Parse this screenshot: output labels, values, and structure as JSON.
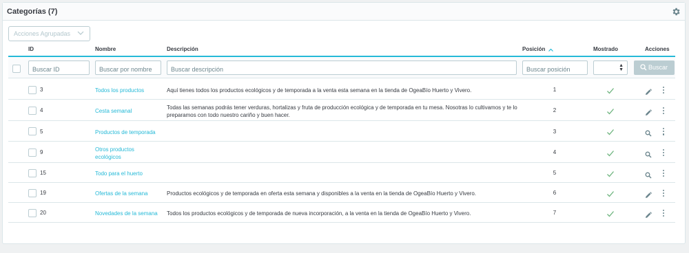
{
  "panel": {
    "title": "Categorías (7)"
  },
  "bulk_actions": {
    "label": "Acciones Agrupadas"
  },
  "columns": {
    "id": "ID",
    "name": "Nombre",
    "description": "Descripción",
    "position": "Posición",
    "displayed": "Mostrado",
    "actions": "Acciones"
  },
  "filters": {
    "id_placeholder": "Buscar ID",
    "name_placeholder": "Buscar por nombre",
    "description_placeholder": "Buscar descripción",
    "position_placeholder": "Buscar posición",
    "search_button": "Buscar"
  },
  "rows": [
    {
      "id": "3",
      "name": "Todos los productos",
      "description": "Aquí tienes todos los productos ecológicos y de temporada a la venta esta semana en la tienda de OgeaBío Huerto y Vivero.",
      "position": "1",
      "displayed": true,
      "action_icon": "edit-icon"
    },
    {
      "id": "4",
      "name": "Cesta semanal",
      "description": "Todas las semanas podrás tener verduras, hortalizas y fruta de producción ecológica y de temporada en tu mesa. Nosotras lo cultivamos y te lo preparamos con todo nuestro cariño y buen hacer.",
      "position": "2",
      "displayed": true,
      "action_icon": "edit-icon"
    },
    {
      "id": "5",
      "name": "Productos de temporada",
      "description": "",
      "position": "3",
      "displayed": true,
      "action_icon": "view-icon"
    },
    {
      "id": "9",
      "name": "Otros productos ecológicos",
      "description": "",
      "position": "4",
      "displayed": true,
      "action_icon": "view-icon"
    },
    {
      "id": "15",
      "name": "Todo para el huerto",
      "description": "",
      "position": "5",
      "displayed": true,
      "action_icon": "view-icon"
    },
    {
      "id": "19",
      "name": "Ofertas de la semana",
      "description": "Productos ecológicos y de temporada en oferta esta semana y disponibles a la venta en la tienda de OgeaBío Huerto y Vivero.",
      "position": "6",
      "displayed": true,
      "action_icon": "edit-icon"
    },
    {
      "id": "20",
      "name": "Novedades de la semana",
      "description": "Todos los productos ecológicos y de temporada de nueva incorporación, a la venta en la tienda de OgeaBío Huerto y Vivero.",
      "position": "7",
      "displayed": true,
      "action_icon": "edit-icon"
    }
  ],
  "colors": {
    "accent": "#25b9d7",
    "check": "#70b580",
    "text": "#363a41",
    "muted": "#6c868e"
  }
}
